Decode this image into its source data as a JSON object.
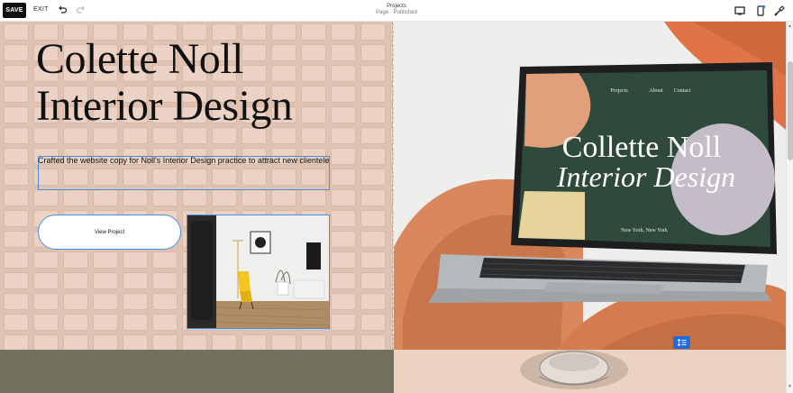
{
  "toolbar": {
    "save_label": "SAVE",
    "exit_label": "EXIT",
    "page_title": "Projects",
    "page_status": "Page · Published",
    "icons": [
      "undo-icon",
      "redo-icon",
      "desktop-icon",
      "mobile-icon",
      "style-brush-icon"
    ]
  },
  "hero": {
    "title_line1": "Colette Noll",
    "title_line2": "Interior Design",
    "caption": "Crafted the website copy for Noll's Interior Design practice to attract new clientele",
    "button_label": "View Project"
  },
  "laptop_screen": {
    "nav": [
      "Projects",
      "About",
      "Contact"
    ],
    "title_line1": "Collette Noll",
    "title_line2": "Interior Design",
    "location": "New York, New York"
  },
  "colors": {
    "left_bg": "#e6cabb",
    "accent_blue": "#4a90e2",
    "section_icon_blue": "#1e6ce0",
    "bottom_left": "#72705f",
    "laptop_screen_green": "#2f4a3c"
  }
}
